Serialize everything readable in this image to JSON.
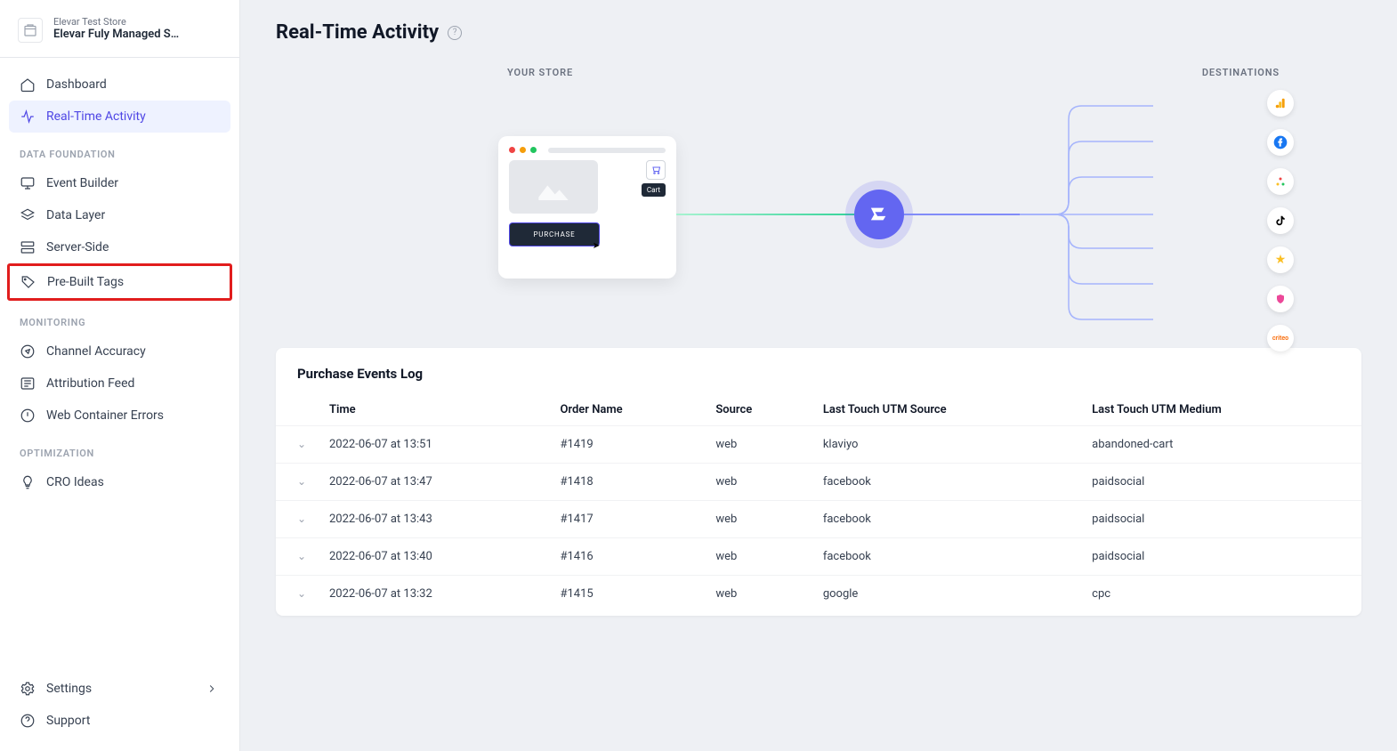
{
  "store": {
    "sub": "Elevar Test Store",
    "main": "Elevar Fuly Managed S…"
  },
  "nav": {
    "dashboard": "Dashboard",
    "realtime": "Real-Time Activity",
    "section_data": "DATA FOUNDATION",
    "event_builder": "Event Builder",
    "data_layer": "Data Layer",
    "server_side": "Server-Side",
    "pre_built_tags": "Pre-Built Tags",
    "section_monitoring": "MONITORING",
    "channel_accuracy": "Channel Accuracy",
    "attribution_feed": "Attribution Feed",
    "web_container_errors": "Web Container Errors",
    "section_optimization": "OPTIMIZATION",
    "cro_ideas": "CRO Ideas",
    "settings": "Settings",
    "support": "Support"
  },
  "page": {
    "title": "Real-Time Activity"
  },
  "flow": {
    "store_label": "YOUR STORE",
    "dest_label": "DESTINATIONS",
    "cart": "Cart",
    "purchase": "PURCHASE"
  },
  "log": {
    "title": "Purchase Events Log",
    "headers": {
      "time": "Time",
      "order": "Order Name",
      "source": "Source",
      "utm_source": "Last Touch UTM Source",
      "utm_medium": "Last Touch UTM Medium"
    },
    "rows": [
      {
        "time": "2022-06-07 at 13:51",
        "order": "#1419",
        "source": "web",
        "utm_source": "klaviyo",
        "utm_medium": "abandoned-cart"
      },
      {
        "time": "2022-06-07 at 13:47",
        "order": "#1418",
        "source": "web",
        "utm_source": "facebook",
        "utm_medium": "paidsocial"
      },
      {
        "time": "2022-06-07 at 13:43",
        "order": "#1417",
        "source": "web",
        "utm_source": "facebook",
        "utm_medium": "paidsocial"
      },
      {
        "time": "2022-06-07 at 13:40",
        "order": "#1416",
        "source": "web",
        "utm_source": "facebook",
        "utm_medium": "paidsocial"
      },
      {
        "time": "2022-06-07 at 13:32",
        "order": "#1415",
        "source": "web",
        "utm_source": "google",
        "utm_medium": "cpc"
      }
    ]
  }
}
